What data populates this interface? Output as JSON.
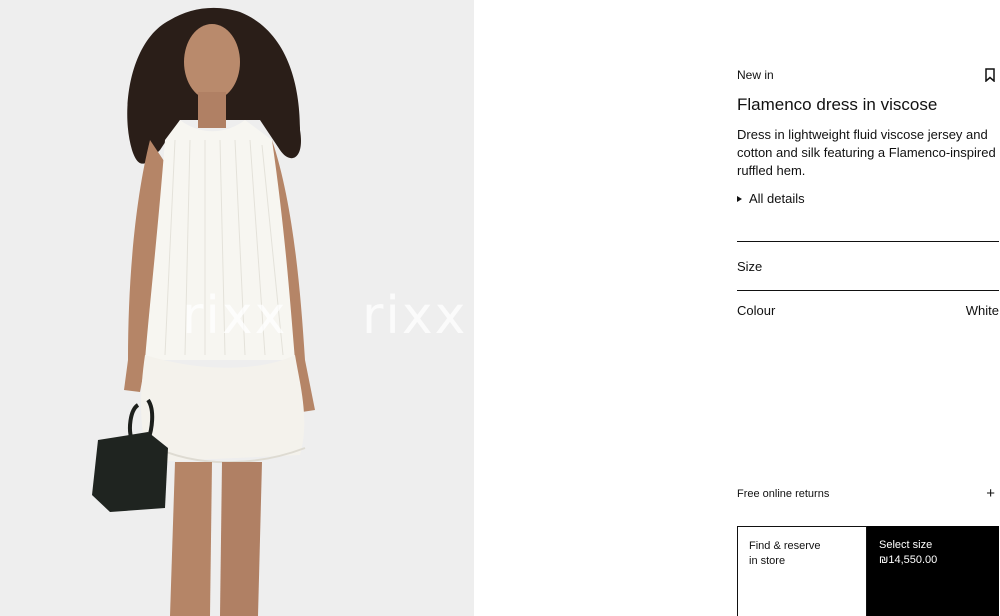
{
  "image": {
    "alt": "",
    "watermarks": [
      "rixx",
      "rixx"
    ]
  },
  "product": {
    "tag": "New in",
    "title": "Flamenco dress in viscose",
    "description": "Dress in lightweight fluid viscose jersey and cotton and silk featuring a Flamenco-inspired ruffled hem.",
    "details_toggle": "All details",
    "size_label": "Size",
    "colour_label": "Colour",
    "colour_value": "White",
    "returns_label": "Free online returns",
    "find_store_line1": "Find & reserve",
    "find_store_line2": "in store",
    "select_size_label": "Select size",
    "price": "₪14,550.00"
  },
  "icons": {
    "bookmark": "bookmark-icon",
    "expand": "triangle-right-icon",
    "plus": "plus-icon"
  },
  "colors": {
    "background": "#ffffff",
    "photo_bg": "#ededed",
    "cta_bg": "#000000",
    "text": "#111111"
  }
}
